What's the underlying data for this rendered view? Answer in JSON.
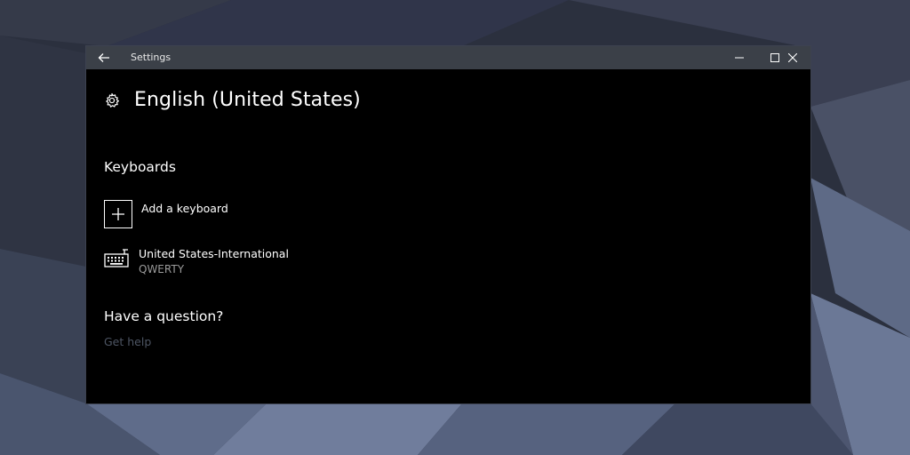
{
  "window": {
    "title": "Settings"
  },
  "icons": {
    "back": "back-arrow-icon",
    "minimize": "minimize-icon",
    "maximize": "maximize-icon",
    "close": "close-icon",
    "settings": "gear-icon",
    "add": "plus-icon",
    "keyboard": "keyboard-icon"
  },
  "page": {
    "title": "English (United States)",
    "keyboards_heading": "Keyboards",
    "add_keyboard_label": "Add a keyboard",
    "keyboards": [
      {
        "name": "United States-International",
        "layout": "QWERTY"
      }
    ],
    "question_heading": "Have a question?",
    "help_link": "Get help"
  },
  "colors": {
    "titlebar": "#3b4048",
    "window_bg": "#000000",
    "link": "#4d5563",
    "secondary_text": "#9a9a9a"
  }
}
